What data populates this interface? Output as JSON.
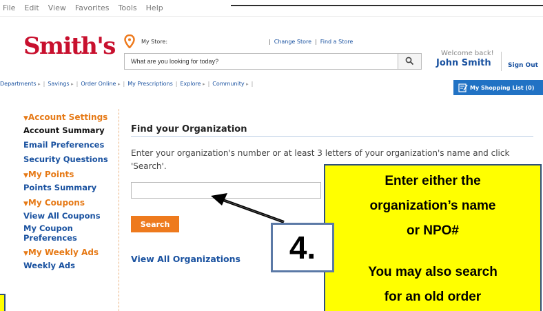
{
  "menubar": {
    "items": [
      "File",
      "Edit",
      "View",
      "Favorites",
      "Tools",
      "Help"
    ]
  },
  "header": {
    "logo": "Smith's",
    "my_store_label": "My Store:",
    "change_store": "Change Store",
    "find_store": "Find a Store",
    "search_placeholder": "What are you looking for today?",
    "welcome": "Welcome back!",
    "username": "John Smith",
    "sign_out": "Sign Out"
  },
  "nav": {
    "items": [
      {
        "label": "Departments",
        "arrow": "▸"
      },
      {
        "label": "Savings",
        "arrow": "▸"
      },
      {
        "label": "Order Online",
        "arrow": "▸"
      },
      {
        "label": "My Prescriptions",
        "arrow": ""
      },
      {
        "label": "Explore",
        "arrow": "▸"
      },
      {
        "label": "Community",
        "arrow": "▸"
      }
    ],
    "shopping_list": "My Shopping List (0)"
  },
  "sidebar": {
    "sections": [
      {
        "title": "Account Settings",
        "items": [
          "Account Summary",
          "Email Preferences",
          "Security Questions"
        ]
      },
      {
        "title": "My Points",
        "items": [
          "Points Summary"
        ]
      },
      {
        "title": "My Coupons",
        "items": [
          "View All Coupons",
          "My Coupon Preferences"
        ]
      },
      {
        "title": "My Weekly Ads",
        "items": [
          "Weekly Ads"
        ]
      }
    ]
  },
  "main": {
    "title": "Find your Organization",
    "instructions": "Enter your organization's number or at least 3 letters of your organization's name and click 'Search'.",
    "search_button": "Search",
    "view_all": "View All Organizations"
  },
  "callout": {
    "line1": "Enter either the",
    "line2": "organization’s name",
    "line3": "or NPO#",
    "line4": "You may also search",
    "line5": "for an old order",
    "step": "4."
  },
  "colors": {
    "brand_red": "#c8102e",
    "link_blue": "#1a52a0",
    "accent_orange": "#ee7a1d",
    "callout_yellow": "#ffff00"
  }
}
